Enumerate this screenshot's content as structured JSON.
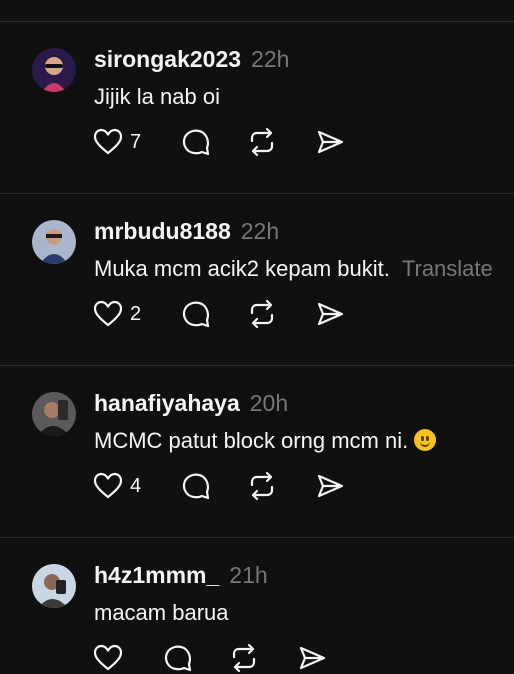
{
  "posts": [
    {
      "username": "sirongak2023",
      "time": "22h",
      "text": "Jijik la nab oi",
      "translate": "",
      "likes": "7",
      "avatar_colors": [
        "#3a1f5c",
        "#c63b6a"
      ]
    },
    {
      "username": "mrbudu8188",
      "time": "22h",
      "text": "Muka mcm acik2 kepam bukit.",
      "translate": "Translate",
      "likes": "2",
      "avatar_colors": [
        "#b9c3d8",
        "#2a3d6b"
      ]
    },
    {
      "username": "hanafiyahaya",
      "time": "20h",
      "text": "MCMC patut block orng mcm ni.",
      "translate": "",
      "likes": "4",
      "avatar_colors": [
        "#6b6b6b",
        "#1a1a1a"
      ]
    },
    {
      "username": "h4z1mmm_",
      "time": "21h",
      "text": "macam barua",
      "translate": "",
      "likes": "",
      "avatar_colors": [
        "#c9d6e4",
        "#3a3a3a"
      ]
    }
  ],
  "icons": {
    "like": "heart-icon",
    "reply": "comment-icon",
    "repost": "repost-icon",
    "share": "send-icon"
  },
  "colors": {
    "background": "#101010",
    "text": "#f3f5f7",
    "muted": "#777777",
    "divider": "#2b2b2b"
  }
}
